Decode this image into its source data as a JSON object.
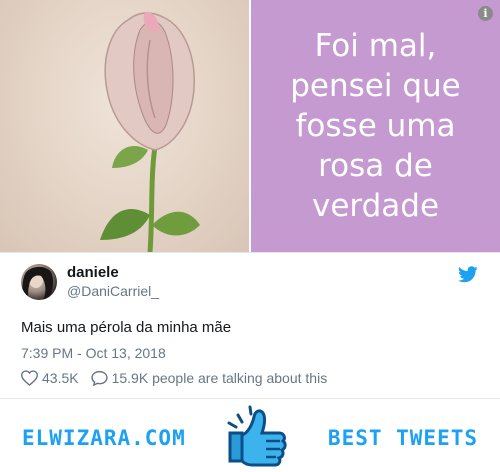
{
  "media": {
    "caption": "Foi mal, pensei que fosse uma rosa de verdade",
    "info_icon": "info-icon",
    "colors": {
      "caption_bg": "#c49ad0",
      "caption_text": "#ffffff"
    }
  },
  "tweet": {
    "display_name": "daniele",
    "handle": "@DaniCarriel_",
    "text": "Mais uma pérola da minha mãe",
    "timestamp": "7:39 PM - Oct 13, 2018",
    "likes": "43.5K",
    "talking": "15.9K people are talking about this",
    "icons": [
      "twitter-bird-icon",
      "heart-icon",
      "speech-bubble-icon"
    ],
    "colors": {
      "twitter_blue": "#1da1f2",
      "muted": "#657786"
    }
  },
  "banner": {
    "site": "ELWIZARA.COM",
    "tag": "BEST TWEETS",
    "icon": "thumbs-up-icon"
  }
}
